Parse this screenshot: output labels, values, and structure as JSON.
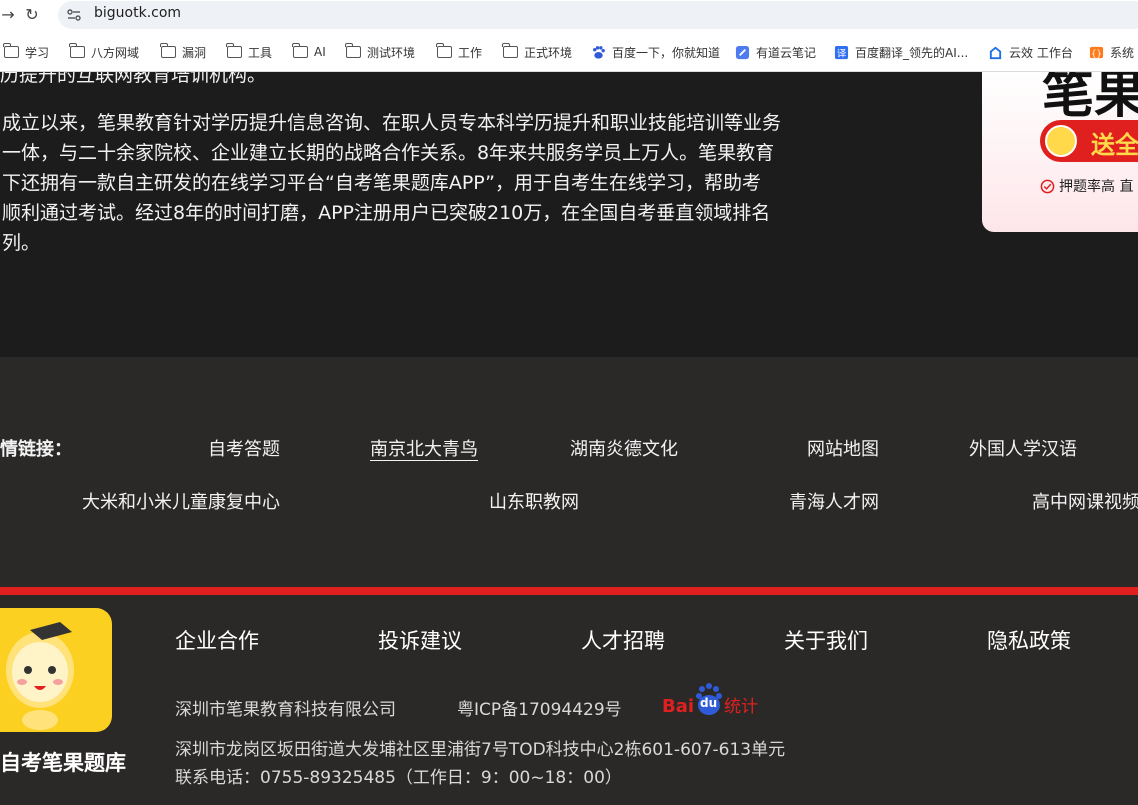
{
  "browser": {
    "url": "biguotk.com"
  },
  "bookmarks": [
    {
      "label": "学习",
      "icon": "folder-icon"
    },
    {
      "label": "八方网域",
      "icon": "folder-icon"
    },
    {
      "label": "漏洞",
      "icon": "folder-icon"
    },
    {
      "label": "工具",
      "icon": "folder-icon"
    },
    {
      "label": "AI",
      "icon": "folder-icon"
    },
    {
      "label": "测试环境",
      "icon": "folder-icon"
    },
    {
      "label": "工作",
      "icon": "folder-icon"
    },
    {
      "label": "正式环境",
      "icon": "folder-icon"
    },
    {
      "label": "百度一下，你就知道",
      "icon": "baidu-paw-icon"
    },
    {
      "label": "有道云笔记",
      "icon": "youdao-note-icon"
    },
    {
      "label": "百度翻译_领先的AI...",
      "icon": "baidu-translate-icon"
    },
    {
      "label": "云效 工作台",
      "icon": "yunxiao-icon"
    },
    {
      "label": "系统",
      "icon": "system-icon"
    }
  ],
  "intro": {
    "lines": [
      "历提升的互联网教育培训机构。",
      "成立以来，笔果教育针对学历提升信息咨询、在职人员专本科学历提升和职业技能培训等业务",
      "一体，与二十余家院校、企业建立长期的战略合作关系。8年来共服务学员上万人。笔果教育",
      "下还拥有一款自主研发的在线学习平台“自考笔果题库APP”，用于自考生在线学习，帮助考",
      "顺利通过考试。经过8年的时间打磨，APP注册用户已突破210万，在全国自考垂直领域排名",
      "列。"
    ]
  },
  "promo": {
    "title": "笔果",
    "badge": "送全",
    "note": "押题率高 直"
  },
  "friend_links": {
    "label": "情链接：",
    "row1": [
      "自考答题",
      "南京北大青鸟",
      "湖南炎德文化",
      "网站地图",
      "外国人学汉语"
    ],
    "row2": [
      "大米和小米儿童康复中心",
      "山东职教网",
      "青海人才网",
      "高中网课视频"
    ]
  },
  "footer": {
    "app_name": "自考笔果题库",
    "nav": [
      "企业合作",
      "投诉建议",
      "人才招聘",
      "关于我们",
      "隐私政策"
    ],
    "company": "深圳市笔果教育科技有限公司",
    "icp": "粤ICP备17094429号",
    "stats_logo": {
      "bai": "Bai",
      "du": "du",
      "tongji": "统计"
    },
    "address": "深圳市龙岗区坂田街道大发埔社区里浦街7号TOD科技中心2栋601-607-613单元",
    "phone": "联系电话：0755-89325485（工作日：9：00~18：00）"
  },
  "colors": {
    "accent_red": "#e0201f",
    "footer_bg": "#2b2928",
    "logo_yellow": "#fcd020"
  }
}
